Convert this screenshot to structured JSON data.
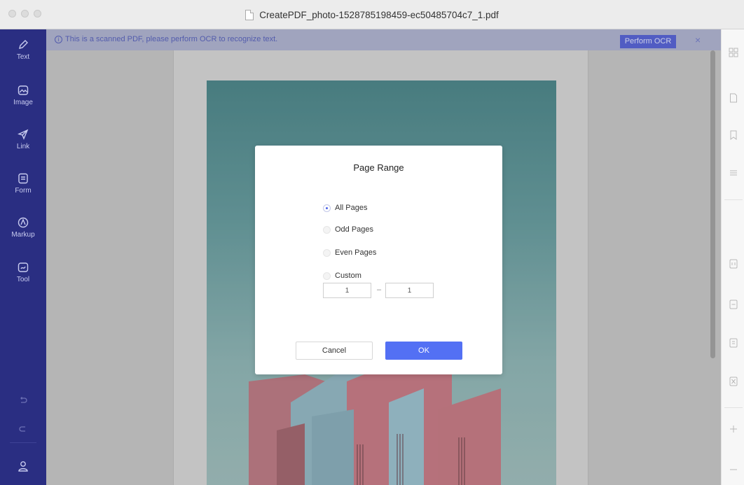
{
  "window": {
    "title": "CreatePDF_photo-1528785198459-ec50485704c7_1.pdf"
  },
  "sidebar": {
    "tools": [
      {
        "label": "Text",
        "icon": "pencil-icon"
      },
      {
        "label": "Image",
        "icon": "image-icon"
      },
      {
        "label": "Link",
        "icon": "link-icon"
      },
      {
        "label": "Form",
        "icon": "form-icon"
      },
      {
        "label": "Markup",
        "icon": "markup-icon"
      },
      {
        "label": "Tool",
        "icon": "tool-icon"
      }
    ],
    "undo_icon": "undo-icon",
    "redo_icon": "redo-icon",
    "user_icon": "user-icon"
  },
  "ocr_banner": {
    "message": "This is a scanned PDF, please perform OCR to recognize text.",
    "button_label": "Perform OCR",
    "close_glyph": "×"
  },
  "dialog": {
    "title": "Page Range",
    "options": [
      {
        "label": "All Pages",
        "checked": true
      },
      {
        "label": "Odd Pages",
        "checked": false
      },
      {
        "label": "Even Pages",
        "checked": false
      },
      {
        "label": "Custom",
        "checked": false
      }
    ],
    "custom_from": "1",
    "custom_to": "1",
    "range_separator": "–",
    "cancel_label": "Cancel",
    "ok_label": "OK"
  },
  "right_panel": {
    "icons": [
      "thumbnails-icon",
      "page-icon",
      "bookmark-icon",
      "list-icon",
      "fit-page-icon",
      "fit-width-icon",
      "single-page-icon",
      "zoom-fit-icon",
      "zoom-in-icon",
      "zoom-out-icon"
    ]
  },
  "colors": {
    "sidebar_bg": "#2a2e82",
    "accent": "#5370f4",
    "ocr_button": "#4856d4",
    "photo_sky": "#3d7c80",
    "building_pink": "#c4707c",
    "building_blue": "#8ab3c0"
  }
}
